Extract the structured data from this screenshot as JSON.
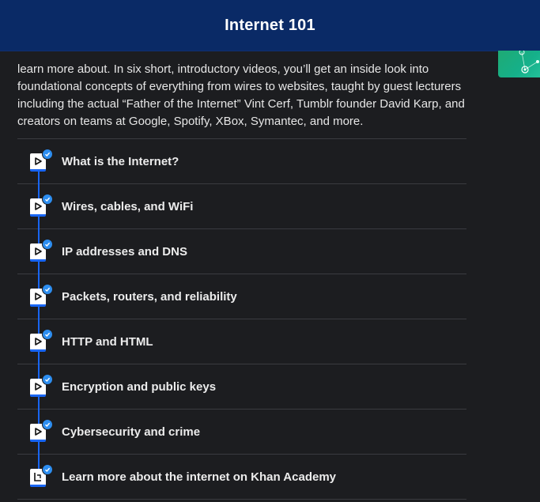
{
  "header": {
    "title": "Internet 101"
  },
  "intro": {
    "text": "learn more about. In six short, introductory videos, you’ll get an inside look into foundational concepts of everything from wires to websites, taught by guest lecturers including the actual “Father of the Internet” Vint Cerf, Tumblr founder David Karp, and creators on teams at Google, Spotify, XBox, Symantec, and more."
  },
  "items": [
    {
      "label": "What is the Internet?",
      "icon": "play-icon",
      "completed": true
    },
    {
      "label": "Wires, cables, and WiFi",
      "icon": "play-icon",
      "completed": true
    },
    {
      "label": "IP addresses and DNS",
      "icon": "play-icon",
      "completed": true
    },
    {
      "label": "Packets, routers, and reliability",
      "icon": "play-icon",
      "completed": true
    },
    {
      "label": "HTTP and HTML",
      "icon": "play-icon",
      "completed": true
    },
    {
      "label": "Encryption and public keys",
      "icon": "play-icon",
      "completed": true
    },
    {
      "label": "Cybersecurity and crime",
      "icon": "play-icon",
      "completed": true
    },
    {
      "label": "Learn more about the internet on Khan Academy",
      "icon": "article-icon",
      "completed": true
    }
  ],
  "colors": {
    "header_bg": "#0a2a66",
    "accent": "#1865f2",
    "check": "#2d8ef0",
    "background": "#1c1d20"
  }
}
